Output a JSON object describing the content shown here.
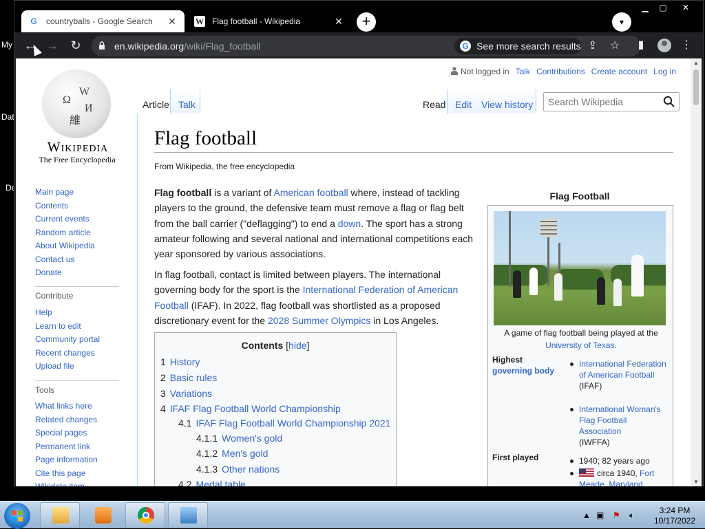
{
  "desktop": {
    "labels": [
      "My",
      "Dat",
      "De"
    ]
  },
  "browser": {
    "tabs": [
      {
        "title": "countryballs - Google Search",
        "favicon": "G"
      },
      {
        "title": "Flag football - Wikipedia",
        "favicon": "W"
      }
    ],
    "new_tab": "+",
    "url_host": "en.wikipedia.org",
    "url_path": "/wiki/Flag_football",
    "see_more": "See more search results"
  },
  "wiki": {
    "wordmark": "Wikipedia",
    "tagline": "The Free Encyclopedia",
    "nav": [
      "Main page",
      "Contents",
      "Current events",
      "Random article",
      "About Wikipedia",
      "Contact us",
      "Donate"
    ],
    "contribute_heading": "Contribute",
    "contribute": [
      "Help",
      "Learn to edit",
      "Community portal",
      "Recent changes",
      "Upload file"
    ],
    "tools_heading": "Tools",
    "tools": [
      "What links here",
      "Related changes",
      "Special pages",
      "Permanent link",
      "Page information",
      "Cite this page",
      "Wikidata item"
    ],
    "user": {
      "status": "Not logged in",
      "talk": "Talk",
      "contributions": "Contributions",
      "create": "Create account",
      "login": "Log in"
    },
    "tabs": {
      "article": "Article",
      "talk": "Talk",
      "read": "Read",
      "edit": "Edit",
      "history": "View history"
    },
    "search_placeholder": "Search Wikipedia",
    "title": "Flag football",
    "from": "From Wikipedia, the free encyclopedia",
    "p1": {
      "b": "Flag football",
      "t1": " is a variant of ",
      "l1": "American football",
      "t2": " where, instead of tackling players to the ground, the defensive team must remove a flag or flag belt from the ball carrier (\"deflagging\") to end a ",
      "l2": "down",
      "t3": ". The sport has a strong amateur following and several national and international competitions each year sponsored by various associations."
    },
    "p2": {
      "t1": "In flag football, contact is limited between players. The international governing body for the sport is the ",
      "l1": "International Federation of American Football",
      "t2": " (IFAF). In 2022, flag football was shortlisted as a proposed discretionary event for the ",
      "l2": "2028 Summer Olympics",
      "t3": " in Los Angeles."
    },
    "toc": {
      "title": "Contents",
      "hide_open": "[",
      "hide": "hide",
      "hide_close": "]",
      "items": [
        {
          "n": "1",
          "t": "History"
        },
        {
          "n": "2",
          "t": "Basic rules"
        },
        {
          "n": "3",
          "t": "Variations"
        },
        {
          "n": "4",
          "t": "IFAF Flag Football World Championship"
        },
        {
          "n": "4.1",
          "t": "IFAF Flag Football World Championship 2021"
        },
        {
          "n": "4.1.1",
          "t": "Women's gold"
        },
        {
          "n": "4.1.2",
          "t": "Men's gold"
        },
        {
          "n": "4.1.3",
          "t": "Other nations"
        },
        {
          "n": "4.2",
          "t": "Medal table"
        }
      ]
    },
    "infobox": {
      "title": "Flag Football",
      "caption_text": "A game of flag football being played at the ",
      "caption_link": "University of Texas",
      "caption_end": ".",
      "gb_label_1": "Highest",
      "gb_label_2": "governing body",
      "gb1_link": "International Federation of American Football",
      "gb1_abbr": "(IFAF)",
      "gb2_link": "International Woman's Flag Football Association",
      "gb2_abbr": "(IWFFA)",
      "fp_label": "First played",
      "fp1": "1940; 82 years ago",
      "fp2_text": "circa 1940, ",
      "fp2_link": "Fort Meade, Maryland"
    }
  },
  "taskbar": {
    "time": "3:24 PM",
    "date": "10/17/2022"
  }
}
